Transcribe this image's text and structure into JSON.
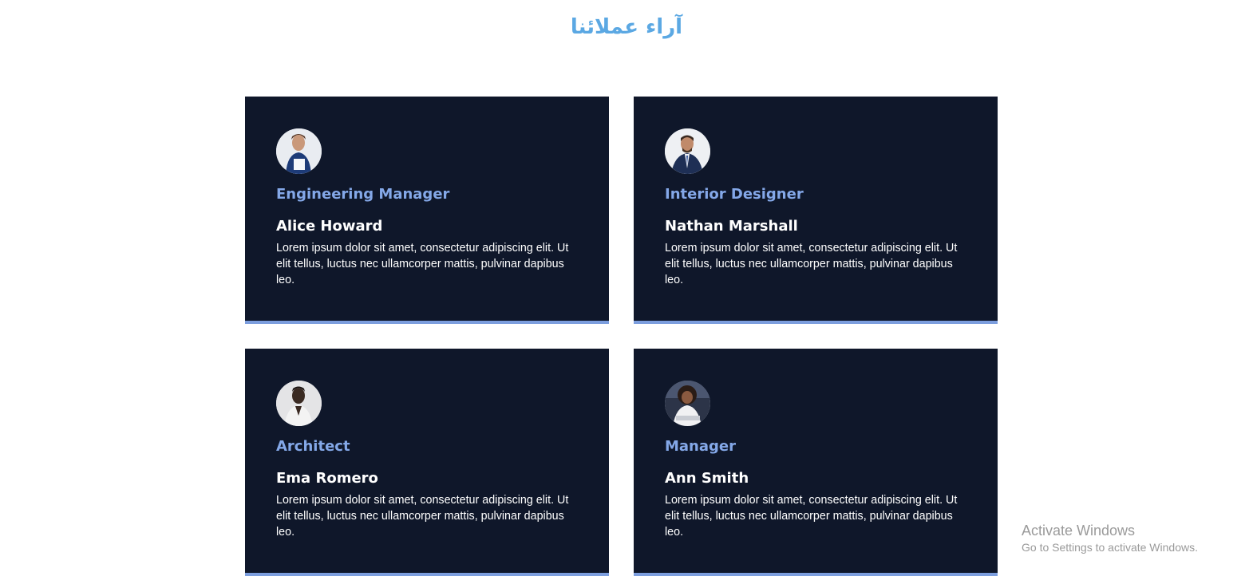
{
  "section": {
    "title": "آراء عملائنا"
  },
  "testimonials": [
    {
      "role": "Engineering Manager",
      "name": "Alice Howard",
      "text": "Lorem ipsum dolor sit amet, consectetur adipiscing elit. Ut elit tellus, luctus nec ullamcorper mattis, pulvinar dapibus leo."
    },
    {
      "role": "Interior Designer",
      "name": "Nathan Marshall",
      "text": "Lorem ipsum dolor sit amet, consectetur adipiscing elit. Ut elit tellus, luctus nec ullamcorper mattis, pulvinar dapibus leo."
    },
    {
      "role": "Architect",
      "name": "Ema Romero",
      "text": "Lorem ipsum dolor sit amet, consectetur adipiscing elit. Ut elit tellus, luctus nec ullamcorper mattis, pulvinar dapibus leo."
    },
    {
      "role": "Manager",
      "name": "Ann Smith",
      "text": "Lorem ipsum dolor sit amet, consectetur adipiscing elit. Ut elit tellus, luctus nec ullamcorper mattis, pulvinar dapibus leo."
    }
  ],
  "watermark": {
    "title": "Activate Windows",
    "subtitle": "Go to Settings to activate Windows."
  },
  "colors": {
    "title": "#5ba8e3",
    "card_background": "#0f172a",
    "role": "#84a8e8",
    "accent_border": "#7c9ede"
  },
  "icons": {
    "avatar": "avatar-photo"
  }
}
